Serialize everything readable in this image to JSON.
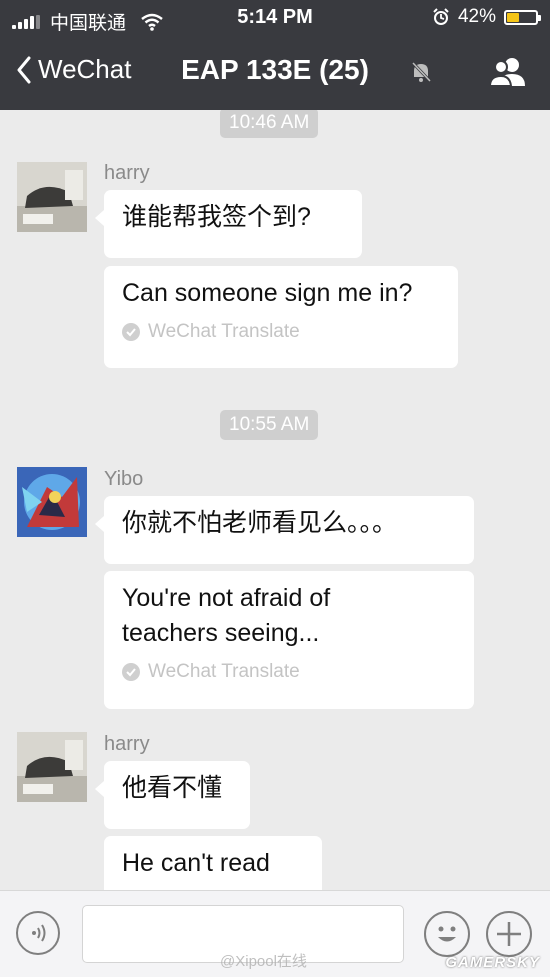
{
  "status_bar": {
    "carrier": "中国联通",
    "time": "5:14 PM",
    "battery": "42%",
    "battery_level": 0.42,
    "battery_color": "#f5c518"
  },
  "nav": {
    "back_label": "WeChat",
    "title": "EAP 133E (25)",
    "icons": [
      "chevron-left-icon",
      "mute-bell-icon",
      "group-members-icon"
    ]
  },
  "messages": [
    {
      "timestamp": "10:46 AM"
    },
    {
      "sender": "harry",
      "text": "谁能帮我签个到?",
      "translation": "Can someone sign me in?",
      "translate_label": "WeChat Translate"
    },
    {
      "timestamp": "10:55 AM"
    },
    {
      "sender": "Yibo",
      "text": "你就不怕老师看见么。。。",
      "translation_lines": [
        "You're not afraid of",
        "teachers seeing..."
      ],
      "translate_label": "WeChat Translate"
    },
    {
      "sender": "harry",
      "text": "他看不懂",
      "translation": "He can't read"
    }
  ],
  "input_bar": {
    "icons": [
      "voice-icon",
      "emoji-icon",
      "plus-icon"
    ]
  },
  "watermarks": {
    "weibo": "@Xipool在线",
    "site": "GAMERSKY"
  },
  "colors": {
    "header_bg": "#393a3f",
    "chat_bg": "#ebebeb",
    "bubble_bg": "#ffffff"
  }
}
